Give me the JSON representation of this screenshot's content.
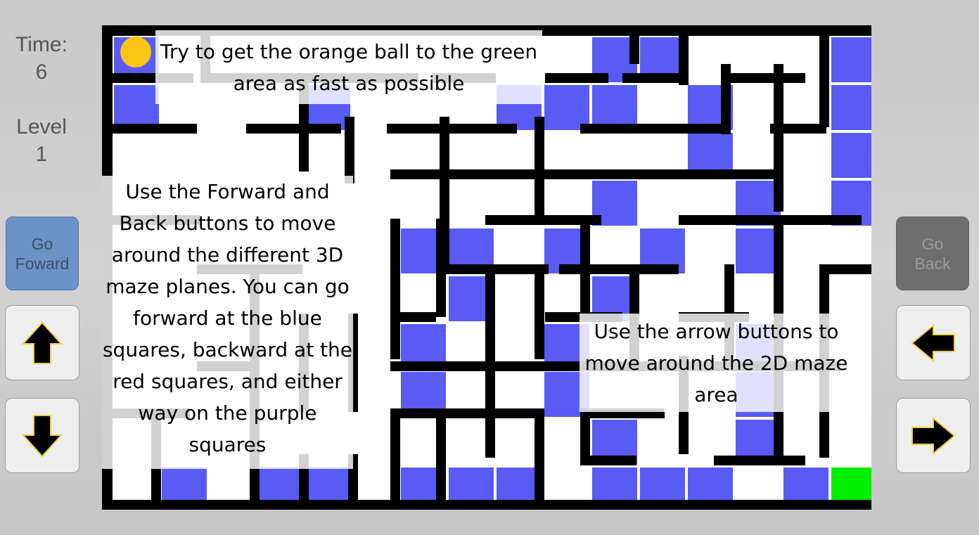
{
  "hud": {
    "time_label": "Time:",
    "time_value": "6",
    "level_label": "Level",
    "level_value": "1"
  },
  "buttons": {
    "go_forward": "Go\nFoward",
    "go_back": "Go\nBack",
    "up_icon": "arrow-up-icon",
    "down_icon": "arrow-down-icon",
    "left_icon": "arrow-left-icon",
    "right_icon": "arrow-right-icon"
  },
  "instructions": {
    "top": "Try to get the orange ball to the green area as fast as possible",
    "left": "Use the Forward and Back buttons to move around the different 3D maze planes. You can go forward at the blue squares, backward at the red squares, and either way on the purple squares",
    "right": "Use the arrow buttons to move around the 2D maze area"
  },
  "colors": {
    "wall": "#000000",
    "floor": "#ffffff",
    "forward_square": "#5a5af5",
    "goal": "#00ee00",
    "ball": "#fcc514",
    "go_forward_bg": "#6b93c6",
    "go_back_bg": "#6e6e6e"
  },
  "maze": {
    "grid_size": "16x10",
    "blue_cells": [
      [
        0,
        0
      ],
      [
        10,
        0
      ],
      [
        11,
        0
      ],
      [
        15,
        0
      ],
      [
        0,
        1
      ],
      [
        4,
        1
      ],
      [
        8,
        1
      ],
      [
        9,
        1
      ],
      [
        10,
        1
      ],
      [
        12,
        1
      ],
      [
        15,
        1
      ],
      [
        12,
        2
      ],
      [
        15,
        2
      ],
      [
        10,
        3
      ],
      [
        13,
        3
      ],
      [
        15,
        3
      ],
      [
        6,
        4
      ],
      [
        7,
        4
      ],
      [
        9,
        4
      ],
      [
        11,
        4
      ],
      [
        13,
        4
      ],
      [
        7,
        5
      ],
      [
        10,
        5
      ],
      [
        6,
        6
      ],
      [
        9,
        6
      ],
      [
        13,
        6
      ],
      [
        6,
        7
      ],
      [
        9,
        7
      ],
      [
        13,
        7
      ],
      [
        10,
        8
      ],
      [
        13,
        8
      ],
      [
        1,
        9
      ],
      [
        3,
        9
      ],
      [
        4,
        9
      ],
      [
        6,
        9
      ],
      [
        7,
        9
      ],
      [
        8,
        9
      ],
      [
        10,
        9
      ],
      [
        11,
        9
      ],
      [
        12,
        9
      ],
      [
        14,
        9
      ]
    ],
    "goal_cell": [
      15,
      9
    ],
    "ball_cell": [
      0,
      0
    ]
  }
}
